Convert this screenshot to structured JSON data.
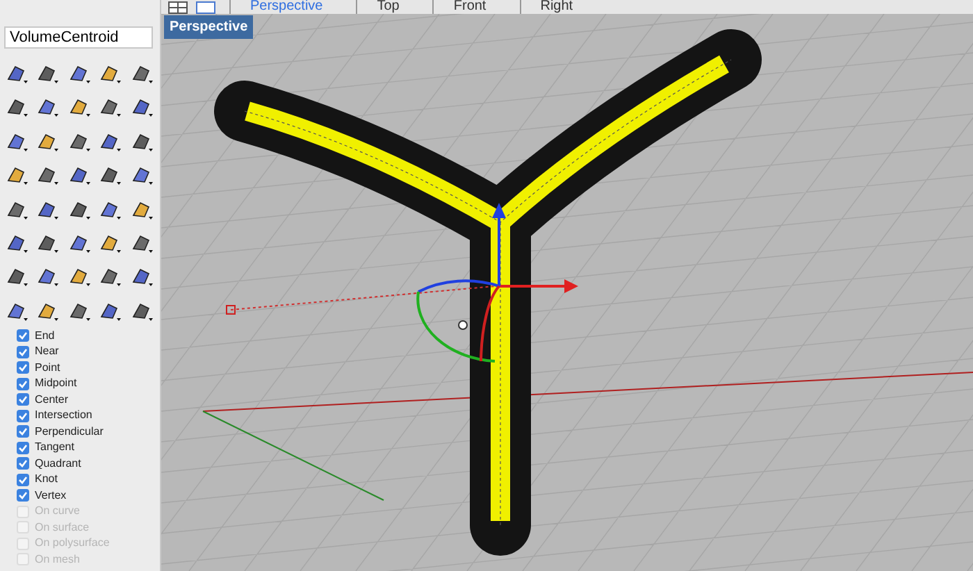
{
  "view_tabs": [
    {
      "label": "Perspective",
      "selected": true
    },
    {
      "label": "Top",
      "selected": false
    },
    {
      "label": "Front",
      "selected": false
    },
    {
      "label": "Right",
      "selected": false
    }
  ],
  "command": {
    "value": "VolumeCentroid"
  },
  "viewport": {
    "title": "Perspective"
  },
  "osnaps": [
    {
      "label": "End",
      "checked": true,
      "disabled": false
    },
    {
      "label": "Near",
      "checked": true,
      "disabled": false
    },
    {
      "label": "Point",
      "checked": true,
      "disabled": false
    },
    {
      "label": "Midpoint",
      "checked": true,
      "disabled": false
    },
    {
      "label": "Center",
      "checked": true,
      "disabled": false
    },
    {
      "label": "Intersection",
      "checked": true,
      "disabled": false
    },
    {
      "label": "Perpendicular",
      "checked": true,
      "disabled": false
    },
    {
      "label": "Tangent",
      "checked": true,
      "disabled": false
    },
    {
      "label": "Quadrant",
      "checked": true,
      "disabled": false
    },
    {
      "label": "Knot",
      "checked": true,
      "disabled": false
    },
    {
      "label": "Vertex",
      "checked": true,
      "disabled": false
    },
    {
      "label": "On curve",
      "checked": false,
      "disabled": true
    },
    {
      "label": "On surface",
      "checked": false,
      "disabled": true
    },
    {
      "label": "On polysurface",
      "checked": false,
      "disabled": true
    },
    {
      "label": "On mesh",
      "checked": false,
      "disabled": true
    }
  ]
}
